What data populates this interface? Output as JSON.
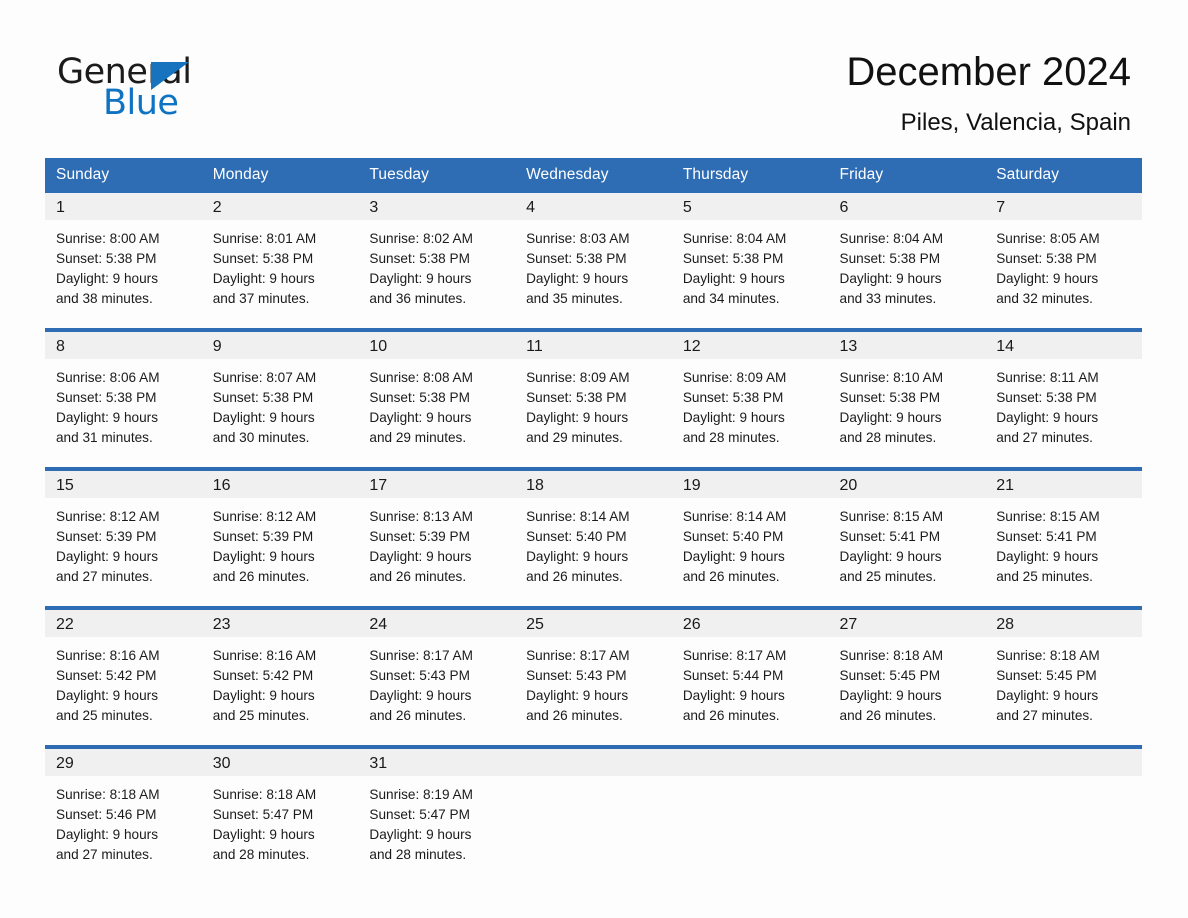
{
  "brand": {
    "name_part1": "General",
    "name_part2": "Blue",
    "triangle_color": "#1773bd",
    "blue_color": "#0f73c4"
  },
  "header": {
    "title": "December 2024",
    "location": "Piles, Valencia, Spain"
  },
  "theme": {
    "header_blue": "#2E6DB4",
    "week_separator_blue": "#2E6DB4",
    "daynum_band": "#F0F0F0",
    "page_background": "#FDFDFD",
    "text_color": "#1A1A1A"
  },
  "weekday_headers": [
    "Sunday",
    "Monday",
    "Tuesday",
    "Wednesday",
    "Thursday",
    "Friday",
    "Saturday"
  ],
  "labels": {
    "sunrise_prefix": "Sunrise:",
    "sunset_prefix": "Sunset:",
    "daylight_prefix": "Daylight:"
  },
  "weeks": [
    {
      "days": [
        {
          "day": "1",
          "detail": "Sunrise: 8:00 AM\nSunset: 5:38 PM\nDaylight: 9 hours\nand 38 minutes.",
          "sunrise": "8:00 AM",
          "sunset": "5:38 PM",
          "daylight": "9 hours and 38 minutes."
        },
        {
          "day": "2",
          "detail": "Sunrise: 8:01 AM\nSunset: 5:38 PM\nDaylight: 9 hours\nand 37 minutes.",
          "sunrise": "8:01 AM",
          "sunset": "5:38 PM",
          "daylight": "9 hours and 37 minutes."
        },
        {
          "day": "3",
          "detail": "Sunrise: 8:02 AM\nSunset: 5:38 PM\nDaylight: 9 hours\nand 36 minutes.",
          "sunrise": "8:02 AM",
          "sunset": "5:38 PM",
          "daylight": "9 hours and 36 minutes."
        },
        {
          "day": "4",
          "detail": "Sunrise: 8:03 AM\nSunset: 5:38 PM\nDaylight: 9 hours\nand 35 minutes.",
          "sunrise": "8:03 AM",
          "sunset": "5:38 PM",
          "daylight": "9 hours and 35 minutes."
        },
        {
          "day": "5",
          "detail": "Sunrise: 8:04 AM\nSunset: 5:38 PM\nDaylight: 9 hours\nand 34 minutes.",
          "sunrise": "8:04 AM",
          "sunset": "5:38 PM",
          "daylight": "9 hours and 34 minutes."
        },
        {
          "day": "6",
          "detail": "Sunrise: 8:04 AM\nSunset: 5:38 PM\nDaylight: 9 hours\nand 33 minutes.",
          "sunrise": "8:04 AM",
          "sunset": "5:38 PM",
          "daylight": "9 hours and 33 minutes."
        },
        {
          "day": "7",
          "detail": "Sunrise: 8:05 AM\nSunset: 5:38 PM\nDaylight: 9 hours\nand 32 minutes.",
          "sunrise": "8:05 AM",
          "sunset": "5:38 PM",
          "daylight": "9 hours and 32 minutes."
        }
      ]
    },
    {
      "days": [
        {
          "day": "8",
          "detail": "Sunrise: 8:06 AM\nSunset: 5:38 PM\nDaylight: 9 hours\nand 31 minutes.",
          "sunrise": "8:06 AM",
          "sunset": "5:38 PM",
          "daylight": "9 hours and 31 minutes."
        },
        {
          "day": "9",
          "detail": "Sunrise: 8:07 AM\nSunset: 5:38 PM\nDaylight: 9 hours\nand 30 minutes.",
          "sunrise": "8:07 AM",
          "sunset": "5:38 PM",
          "daylight": "9 hours and 30 minutes."
        },
        {
          "day": "10",
          "detail": "Sunrise: 8:08 AM\nSunset: 5:38 PM\nDaylight: 9 hours\nand 29 minutes.",
          "sunrise": "8:08 AM",
          "sunset": "5:38 PM",
          "daylight": "9 hours and 29 minutes."
        },
        {
          "day": "11",
          "detail": "Sunrise: 8:09 AM\nSunset: 5:38 PM\nDaylight: 9 hours\nand 29 minutes.",
          "sunrise": "8:09 AM",
          "sunset": "5:38 PM",
          "daylight": "9 hours and 29 minutes."
        },
        {
          "day": "12",
          "detail": "Sunrise: 8:09 AM\nSunset: 5:38 PM\nDaylight: 9 hours\nand 28 minutes.",
          "sunrise": "8:09 AM",
          "sunset": "5:38 PM",
          "daylight": "9 hours and 28 minutes."
        },
        {
          "day": "13",
          "detail": "Sunrise: 8:10 AM\nSunset: 5:38 PM\nDaylight: 9 hours\nand 28 minutes.",
          "sunrise": "8:10 AM",
          "sunset": "5:38 PM",
          "daylight": "9 hours and 28 minutes."
        },
        {
          "day": "14",
          "detail": "Sunrise: 8:11 AM\nSunset: 5:38 PM\nDaylight: 9 hours\nand 27 minutes.",
          "sunrise": "8:11 AM",
          "sunset": "5:38 PM",
          "daylight": "9 hours and 27 minutes."
        }
      ]
    },
    {
      "days": [
        {
          "day": "15",
          "detail": "Sunrise: 8:12 AM\nSunset: 5:39 PM\nDaylight: 9 hours\nand 27 minutes.",
          "sunrise": "8:12 AM",
          "sunset": "5:39 PM",
          "daylight": "9 hours and 27 minutes."
        },
        {
          "day": "16",
          "detail": "Sunrise: 8:12 AM\nSunset: 5:39 PM\nDaylight: 9 hours\nand 26 minutes.",
          "sunrise": "8:12 AM",
          "sunset": "5:39 PM",
          "daylight": "9 hours and 26 minutes."
        },
        {
          "day": "17",
          "detail": "Sunrise: 8:13 AM\nSunset: 5:39 PM\nDaylight: 9 hours\nand 26 minutes.",
          "sunrise": "8:13 AM",
          "sunset": "5:39 PM",
          "daylight": "9 hours and 26 minutes."
        },
        {
          "day": "18",
          "detail": "Sunrise: 8:14 AM\nSunset: 5:40 PM\nDaylight: 9 hours\nand 26 minutes.",
          "sunrise": "8:14 AM",
          "sunset": "5:40 PM",
          "daylight": "9 hours and 26 minutes."
        },
        {
          "day": "19",
          "detail": "Sunrise: 8:14 AM\nSunset: 5:40 PM\nDaylight: 9 hours\nand 26 minutes.",
          "sunrise": "8:14 AM",
          "sunset": "5:40 PM",
          "daylight": "9 hours and 26 minutes."
        },
        {
          "day": "20",
          "detail": "Sunrise: 8:15 AM\nSunset: 5:41 PM\nDaylight: 9 hours\nand 25 minutes.",
          "sunrise": "8:15 AM",
          "sunset": "5:41 PM",
          "daylight": "9 hours and 25 minutes."
        },
        {
          "day": "21",
          "detail": "Sunrise: 8:15 AM\nSunset: 5:41 PM\nDaylight: 9 hours\nand 25 minutes.",
          "sunrise": "8:15 AM",
          "sunset": "5:41 PM",
          "daylight": "9 hours and 25 minutes."
        }
      ]
    },
    {
      "days": [
        {
          "day": "22",
          "detail": "Sunrise: 8:16 AM\nSunset: 5:42 PM\nDaylight: 9 hours\nand 25 minutes.",
          "sunrise": "8:16 AM",
          "sunset": "5:42 PM",
          "daylight": "9 hours and 25 minutes."
        },
        {
          "day": "23",
          "detail": "Sunrise: 8:16 AM\nSunset: 5:42 PM\nDaylight: 9 hours\nand 25 minutes.",
          "sunrise": "8:16 AM",
          "sunset": "5:42 PM",
          "daylight": "9 hours and 25 minutes."
        },
        {
          "day": "24",
          "detail": "Sunrise: 8:17 AM\nSunset: 5:43 PM\nDaylight: 9 hours\nand 26 minutes.",
          "sunrise": "8:17 AM",
          "sunset": "5:43 PM",
          "daylight": "9 hours and 26 minutes."
        },
        {
          "day": "25",
          "detail": "Sunrise: 8:17 AM\nSunset: 5:43 PM\nDaylight: 9 hours\nand 26 minutes.",
          "sunrise": "8:17 AM",
          "sunset": "5:43 PM",
          "daylight": "9 hours and 26 minutes."
        },
        {
          "day": "26",
          "detail": "Sunrise: 8:17 AM\nSunset: 5:44 PM\nDaylight: 9 hours\nand 26 minutes.",
          "sunrise": "8:17 AM",
          "sunset": "5:44 PM",
          "daylight": "9 hours and 26 minutes."
        },
        {
          "day": "27",
          "detail": "Sunrise: 8:18 AM\nSunset: 5:45 PM\nDaylight: 9 hours\nand 26 minutes.",
          "sunrise": "8:18 AM",
          "sunset": "5:45 PM",
          "daylight": "9 hours and 26 minutes."
        },
        {
          "day": "28",
          "detail": "Sunrise: 8:18 AM\nSunset: 5:45 PM\nDaylight: 9 hours\nand 27 minutes.",
          "sunrise": "8:18 AM",
          "sunset": "5:45 PM",
          "daylight": "9 hours and 27 minutes."
        }
      ]
    },
    {
      "days": [
        {
          "day": "29",
          "detail": "Sunrise: 8:18 AM\nSunset: 5:46 PM\nDaylight: 9 hours\nand 27 minutes.",
          "sunrise": "8:18 AM",
          "sunset": "5:46 PM",
          "daylight": "9 hours and 27 minutes."
        },
        {
          "day": "30",
          "detail": "Sunrise: 8:18 AM\nSunset: 5:47 PM\nDaylight: 9 hours\nand 28 minutes.",
          "sunrise": "8:18 AM",
          "sunset": "5:47 PM",
          "daylight": "9 hours and 28 minutes."
        },
        {
          "day": "31",
          "detail": "Sunrise: 8:19 AM\nSunset: 5:47 PM\nDaylight: 9 hours\nand 28 minutes.",
          "sunrise": "8:19 AM",
          "sunset": "5:47 PM",
          "daylight": "9 hours and 28 minutes."
        },
        {
          "day": "",
          "detail": ""
        },
        {
          "day": "",
          "detail": ""
        },
        {
          "day": "",
          "detail": ""
        },
        {
          "day": "",
          "detail": ""
        }
      ]
    }
  ]
}
